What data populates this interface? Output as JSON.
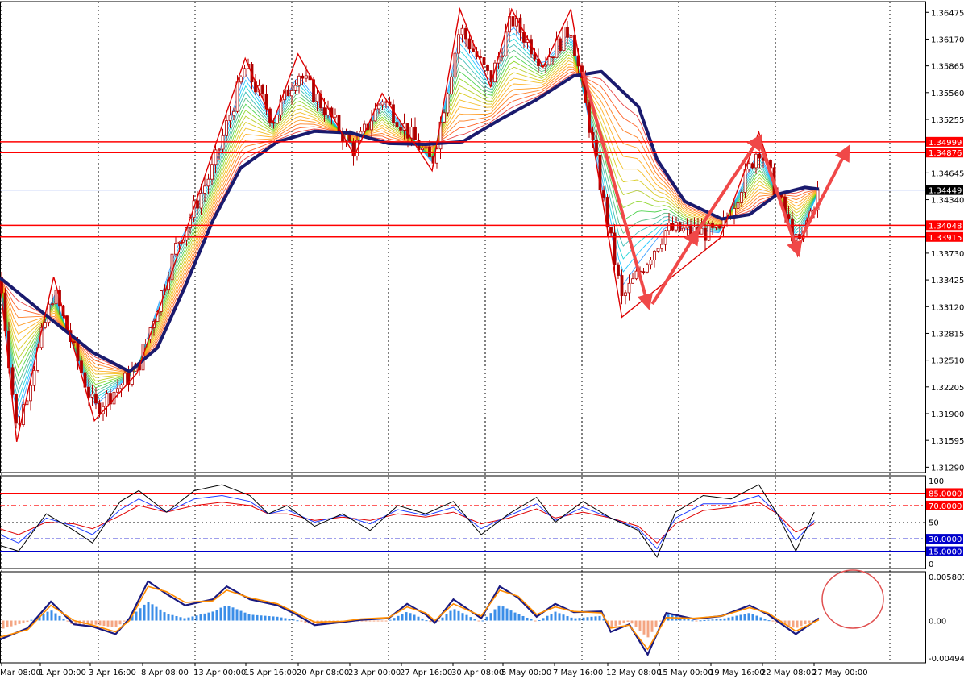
{
  "chart_data": {
    "type": "line",
    "main": {
      "price_ticks": [
        "1.36475",
        "1.36170",
        "1.35865",
        "1.35560",
        "1.35255",
        "1.34645",
        "1.34340",
        "1.33730",
        "1.33425",
        "1.33120",
        "1.32815",
        "1.32510",
        "1.32205",
        "1.31900",
        "1.31595",
        "1.31290"
      ],
      "current_price": "1.34449",
      "levels": [
        {
          "value": "1.34999",
          "label": "1.34999",
          "color": "#ff0000"
        },
        {
          "value": "1.34876",
          "label": "1.34876",
          "color": "#ff0000"
        },
        {
          "value": "1.34048",
          "label": "1.34048",
          "color": "#ff0000"
        },
        {
          "value": "1.33915",
          "label": "1.33915",
          "color": "#ff0000"
        }
      ],
      "current_price_color": "#4169e1",
      "zigzag_color": "#dd0000",
      "trend_ma_color": "#1a1a6e",
      "candle_color": "#b00000",
      "zigzag_points": [
        [
          0,
          1.334
        ],
        [
          0.018,
          1.3158
        ],
        [
          0.058,
          1.3346
        ],
        [
          0.102,
          1.3182
        ],
        [
          0.148,
          1.3236
        ],
        [
          0.265,
          1.3595
        ],
        [
          0.295,
          1.3522
        ],
        [
          0.322,
          1.36
        ],
        [
          0.383,
          1.3484
        ],
        [
          0.413,
          1.3555
        ],
        [
          0.467,
          1.3467
        ],
        [
          0.497,
          1.3651
        ],
        [
          0.53,
          1.3563
        ],
        [
          0.553,
          1.3651
        ],
        [
          0.587,
          1.3585
        ],
        [
          0.617,
          1.3651
        ],
        [
          0.672,
          1.33
        ],
        [
          0.778,
          1.339
        ],
        [
          0.82,
          1.3511
        ],
        [
          0.862,
          1.337
        ],
        [
          0.875,
          1.342
        ]
      ],
      "trend_ma": [
        [
          0,
          1.3345
        ],
        [
          0.05,
          1.3302
        ],
        [
          0.1,
          1.326
        ],
        [
          0.14,
          1.3238
        ],
        [
          0.17,
          1.3265
        ],
        [
          0.2,
          1.3335
        ],
        [
          0.23,
          1.341
        ],
        [
          0.26,
          1.347
        ],
        [
          0.3,
          1.35
        ],
        [
          0.34,
          1.3512
        ],
        [
          0.38,
          1.351
        ],
        [
          0.42,
          1.3498
        ],
        [
          0.46,
          1.3497
        ],
        [
          0.5,
          1.35
        ],
        [
          0.54,
          1.3525
        ],
        [
          0.58,
          1.3548
        ],
        [
          0.62,
          1.3575
        ],
        [
          0.65,
          1.358
        ],
        [
          0.69,
          1.354
        ],
        [
          0.71,
          1.348
        ],
        [
          0.74,
          1.3432
        ],
        [
          0.78,
          1.3412
        ],
        [
          0.81,
          1.3417
        ],
        [
          0.84,
          1.344
        ],
        [
          0.87,
          1.3448
        ],
        [
          0.885,
          1.3446
        ]
      ],
      "close_path": [
        [
          0,
          1.3345
        ],
        [
          0.018,
          1.317
        ],
        [
          0.058,
          1.333
        ],
        [
          0.102,
          1.3195
        ],
        [
          0.148,
          1.324
        ],
        [
          0.19,
          1.338
        ],
        [
          0.23,
          1.347
        ],
        [
          0.265,
          1.3585
        ],
        [
          0.295,
          1.3525
        ],
        [
          0.322,
          1.358
        ],
        [
          0.383,
          1.349
        ],
        [
          0.413,
          1.355
        ],
        [
          0.467,
          1.3475
        ],
        [
          0.497,
          1.363
        ],
        [
          0.53,
          1.357
        ],
        [
          0.553,
          1.364
        ],
        [
          0.587,
          1.359
        ],
        [
          0.617,
          1.363
        ],
        [
          0.672,
          1.332
        ],
        [
          0.72,
          1.34
        ],
        [
          0.778,
          1.3395
        ],
        [
          0.82,
          1.3495
        ],
        [
          0.862,
          1.338
        ],
        [
          0.885,
          1.3445
        ]
      ],
      "arrows": [
        [
          [
            0.63,
            1.358
          ],
          [
            0.7,
            1.3315
          ]
        ],
        [
          [
            0.705,
            1.3315
          ],
          [
            0.752,
            1.3395
          ]
        ],
        [
          [
            0.752,
            1.3395
          ],
          [
            0.82,
            1.3503
          ]
        ],
        [
          [
            0.82,
            1.3503
          ],
          [
            0.862,
            1.3375
          ]
        ],
        [
          [
            0.868,
            1.3395
          ],
          [
            0.915,
            1.349
          ]
        ]
      ],
      "arrow_color": "#f04848"
    },
    "oscillator": {
      "ticks": [
        "100",
        "50",
        "0"
      ],
      "levels": [
        {
          "value": 85,
          "label": "85.0000",
          "color": "#ff0000"
        },
        {
          "value": 70,
          "label": "70.0000",
          "color": "#ff0000"
        },
        {
          "value": 30,
          "label": "30.0000",
          "color": "#0000cc"
        },
        {
          "value": 15,
          "label": "15.0000",
          "color": "#0000cc"
        }
      ],
      "fast": [
        [
          0,
          22
        ],
        [
          0.02,
          15
        ],
        [
          0.05,
          60
        ],
        [
          0.08,
          40
        ],
        [
          0.1,
          25
        ],
        [
          0.13,
          75
        ],
        [
          0.15,
          88
        ],
        [
          0.18,
          62
        ],
        [
          0.21,
          88
        ],
        [
          0.24,
          95
        ],
        [
          0.27,
          82
        ],
        [
          0.29,
          60
        ],
        [
          0.31,
          70
        ],
        [
          0.34,
          45
        ],
        [
          0.37,
          60
        ],
        [
          0.4,
          40
        ],
        [
          0.43,
          70
        ],
        [
          0.46,
          60
        ],
        [
          0.49,
          75
        ],
        [
          0.52,
          35
        ],
        [
          0.55,
          60
        ],
        [
          0.58,
          80
        ],
        [
          0.6,
          50
        ],
        [
          0.63,
          75
        ],
        [
          0.66,
          55
        ],
        [
          0.69,
          40
        ],
        [
          0.71,
          8
        ],
        [
          0.73,
          62
        ],
        [
          0.76,
          82
        ],
        [
          0.79,
          78
        ],
        [
          0.82,
          95
        ],
        [
          0.84,
          60
        ],
        [
          0.86,
          15
        ],
        [
          0.88,
          62
        ]
      ],
      "mid": [
        [
          0,
          35
        ],
        [
          0.02,
          25
        ],
        [
          0.05,
          55
        ],
        [
          0.08,
          45
        ],
        [
          0.1,
          35
        ],
        [
          0.13,
          65
        ],
        [
          0.15,
          78
        ],
        [
          0.18,
          62
        ],
        [
          0.21,
          78
        ],
        [
          0.24,
          82
        ],
        [
          0.27,
          75
        ],
        [
          0.29,
          60
        ],
        [
          0.31,
          65
        ],
        [
          0.34,
          50
        ],
        [
          0.37,
          58
        ],
        [
          0.4,
          48
        ],
        [
          0.43,
          65
        ],
        [
          0.46,
          58
        ],
        [
          0.49,
          68
        ],
        [
          0.52,
          42
        ],
        [
          0.55,
          58
        ],
        [
          0.58,
          72
        ],
        [
          0.6,
          52
        ],
        [
          0.63,
          68
        ],
        [
          0.66,
          55
        ],
        [
          0.69,
          42
        ],
        [
          0.71,
          18
        ],
        [
          0.73,
          55
        ],
        [
          0.76,
          72
        ],
        [
          0.79,
          72
        ],
        [
          0.82,
          82
        ],
        [
          0.84,
          60
        ],
        [
          0.86,
          28
        ],
        [
          0.88,
          52
        ]
      ],
      "slow": [
        [
          0,
          42
        ],
        [
          0.02,
          35
        ],
        [
          0.05,
          50
        ],
        [
          0.08,
          48
        ],
        [
          0.1,
          42
        ],
        [
          0.13,
          58
        ],
        [
          0.15,
          70
        ],
        [
          0.18,
          62
        ],
        [
          0.21,
          70
        ],
        [
          0.24,
          74
        ],
        [
          0.27,
          70
        ],
        [
          0.29,
          60
        ],
        [
          0.31,
          60
        ],
        [
          0.34,
          52
        ],
        [
          0.37,
          56
        ],
        [
          0.4,
          52
        ],
        [
          0.43,
          60
        ],
        [
          0.46,
          56
        ],
        [
          0.49,
          62
        ],
        [
          0.52,
          48
        ],
        [
          0.55,
          55
        ],
        [
          0.58,
          66
        ],
        [
          0.6,
          55
        ],
        [
          0.63,
          62
        ],
        [
          0.66,
          55
        ],
        [
          0.69,
          45
        ],
        [
          0.71,
          25
        ],
        [
          0.73,
          48
        ],
        [
          0.76,
          64
        ],
        [
          0.79,
          68
        ],
        [
          0.82,
          74
        ],
        [
          0.84,
          60
        ],
        [
          0.86,
          38
        ],
        [
          0.88,
          48
        ]
      ]
    },
    "macd": {
      "ticks": [
        "0.0058016",
        "0.00",
        "-0.0049453"
      ],
      "max": 0.0058016,
      "min": -0.0049453,
      "main_line": [
        [
          0,
          -0.0025
        ],
        [
          0.03,
          -0.001
        ],
        [
          0.055,
          0.0025
        ],
        [
          0.08,
          -0.0005
        ],
        [
          0.1,
          -0.0008
        ],
        [
          0.125,
          -0.0018
        ],
        [
          0.14,
          0.0003
        ],
        [
          0.16,
          0.0052
        ],
        [
          0.18,
          0.0035
        ],
        [
          0.2,
          0.002
        ],
        [
          0.23,
          0.0028
        ],
        [
          0.245,
          0.0045
        ],
        [
          0.27,
          0.0028
        ],
        [
          0.3,
          0.002
        ],
        [
          0.32,
          0.0008
        ],
        [
          0.34,
          -0.0006
        ],
        [
          0.37,
          -0.0002
        ],
        [
          0.39,
          0.0001
        ],
        [
          0.42,
          0.0003
        ],
        [
          0.44,
          0.0022
        ],
        [
          0.46,
          0.0008
        ],
        [
          0.47,
          -0.0003
        ],
        [
          0.49,
          0.0028
        ],
        [
          0.52,
          0.0003
        ],
        [
          0.54,
          0.0045
        ],
        [
          0.56,
          0.003
        ],
        [
          0.58,
          0.0005
        ],
        [
          0.6,
          0.0022
        ],
        [
          0.62,
          0.0011
        ],
        [
          0.65,
          0.0012
        ],
        [
          0.66,
          -0.0015
        ],
        [
          0.68,
          -0.0005
        ],
        [
          0.7,
          -0.0045
        ],
        [
          0.72,
          0.001
        ],
        [
          0.75,
          0.0002
        ],
        [
          0.78,
          0.0006
        ],
        [
          0.81,
          0.002
        ],
        [
          0.83,
          0.0008
        ],
        [
          0.86,
          -0.0018
        ],
        [
          0.885,
          0.0003
        ]
      ],
      "signal_line": [
        [
          0,
          -0.0022
        ],
        [
          0.03,
          -0.0012
        ],
        [
          0.055,
          0.002
        ],
        [
          0.08,
          0.0
        ],
        [
          0.1,
          -0.0006
        ],
        [
          0.125,
          -0.0015
        ],
        [
          0.14,
          0.0
        ],
        [
          0.16,
          0.0045
        ],
        [
          0.18,
          0.0038
        ],
        [
          0.2,
          0.0024
        ],
        [
          0.23,
          0.0026
        ],
        [
          0.245,
          0.004
        ],
        [
          0.27,
          0.003
        ],
        [
          0.3,
          0.0022
        ],
        [
          0.32,
          0.001
        ],
        [
          0.34,
          -0.0002
        ],
        [
          0.37,
          -0.0001
        ],
        [
          0.39,
          0.0002
        ],
        [
          0.42,
          0.0004
        ],
        [
          0.44,
          0.0018
        ],
        [
          0.46,
          0.001
        ],
        [
          0.47,
          0.0
        ],
        [
          0.49,
          0.0022
        ],
        [
          0.52,
          0.0006
        ],
        [
          0.54,
          0.004
        ],
        [
          0.56,
          0.0032
        ],
        [
          0.58,
          0.0008
        ],
        [
          0.6,
          0.0018
        ],
        [
          0.62,
          0.0012
        ],
        [
          0.65,
          0.001
        ],
        [
          0.66,
          -0.001
        ],
        [
          0.68,
          -0.0006
        ],
        [
          0.7,
          -0.0038
        ],
        [
          0.72,
          0.0004
        ],
        [
          0.75,
          0.0003
        ],
        [
          0.78,
          0.0006
        ],
        [
          0.81,
          0.0017
        ],
        [
          0.83,
          0.001
        ],
        [
          0.86,
          -0.0014
        ],
        [
          0.885,
          0.0001
        ]
      ],
      "main_color": "#1a1a80",
      "signal_color": "#ff8c00",
      "hist_pos_color": "#3b8ee8",
      "hist_neg_color": "#f4a582",
      "circle_color": "#e05050"
    },
    "time_labels": [
      "Mar 08:00",
      "1 Apr 00:00",
      "3 Apr 16:00",
      "8 Apr 08:00",
      "13 Apr 00:00",
      "15 Apr 16:00",
      "20 Apr 08:00",
      "23 Apr 00:00",
      "27 Apr 16:00",
      "30 Apr 08:00",
      "5 May 00:00",
      "7 May 16:00",
      "12 May 08:00",
      "15 May 00:00",
      "19 May 16:00",
      "22 May 08:00",
      "27 May 00:00"
    ],
    "background": "#ffffff",
    "grid": "on",
    "grid_color": "#000000"
  }
}
